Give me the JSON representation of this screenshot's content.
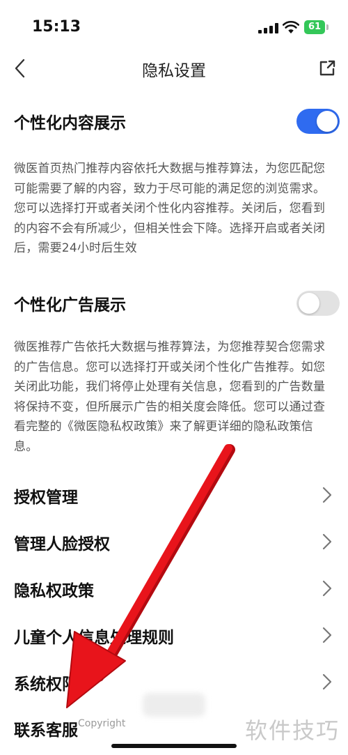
{
  "status_bar": {
    "time": "15:13",
    "battery": "61"
  },
  "nav": {
    "title": "隐私设置",
    "back_icon": "chevron-left-icon",
    "share_icon": "share-out-icon"
  },
  "content_section": {
    "title": "个性化内容展示",
    "enabled": true,
    "description": "微医首页热门推荐内容依托大数据与推荐算法，为您匹配您可能需要了解的内容，致力于尽可能的满足您的浏览需求。您可以选择打开或者关闭个性化内容推荐。关闭后，您看到的内容不会有所减少，但相关性会下降。选择开启或者关闭后，需要24小时后生效"
  },
  "ad_section": {
    "title": "个性化广告展示",
    "enabled": false,
    "description": "微医推荐广告依托大数据与推荐算法，为您推荐契合您需求的广告信息。您可以选择打开或关闭个性化广告推荐。如您关闭此功能，我们将停止处理有关信息，您看到的广告数量将保持不变，但所展示广告的相关度会降低。您可以通过查看完整的《微医隐私权政策》来了解更详细的隐私政策信息。"
  },
  "menu": {
    "items": [
      {
        "label": "授权管理"
      },
      {
        "label": "管理人脸授权"
      },
      {
        "label": "隐私权政策"
      },
      {
        "label": "儿童个人信息处理规则"
      },
      {
        "label": "系统权限"
      },
      {
        "label": "联系客服"
      }
    ]
  },
  "footer": {
    "copyright": "Copyright",
    "watermark": "软件技巧"
  },
  "colors": {
    "accent": "#2f6bf0",
    "annotation_arrow": "#e8141b"
  }
}
